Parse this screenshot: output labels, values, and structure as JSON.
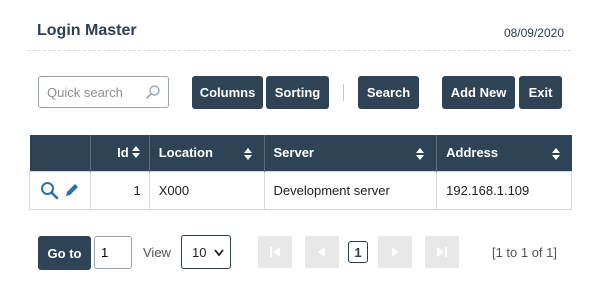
{
  "header": {
    "title": "Login Master",
    "date": "08/09/2020"
  },
  "toolbar": {
    "search_placeholder": "Quick search",
    "columns_label": "Columns",
    "sorting_label": "Sorting",
    "search_label": "Search",
    "add_new_label": "Add New",
    "exit_label": "Exit"
  },
  "table": {
    "headers": [
      "Id",
      "Location",
      "Server",
      "Address"
    ],
    "rows": [
      {
        "id": "1",
        "location": "X000",
        "server": "Development server",
        "address": "192.168.1.109"
      }
    ]
  },
  "pager": {
    "goto_label": "Go to",
    "goto_value": "1",
    "view_label": "View",
    "page_size": "10",
    "page_size_options": [
      "10"
    ],
    "current_page": "1",
    "summary": "[1 to 1 of 1]"
  },
  "colors": {
    "header_bg": "#2f4357",
    "accent": "#2f6fa6",
    "page_bg": "#ffffff"
  },
  "icons": [
    "search-icon",
    "view-icon",
    "edit-icon",
    "sort-icon",
    "first-page-icon",
    "prev-page-icon",
    "next-page-icon",
    "last-page-icon"
  ]
}
